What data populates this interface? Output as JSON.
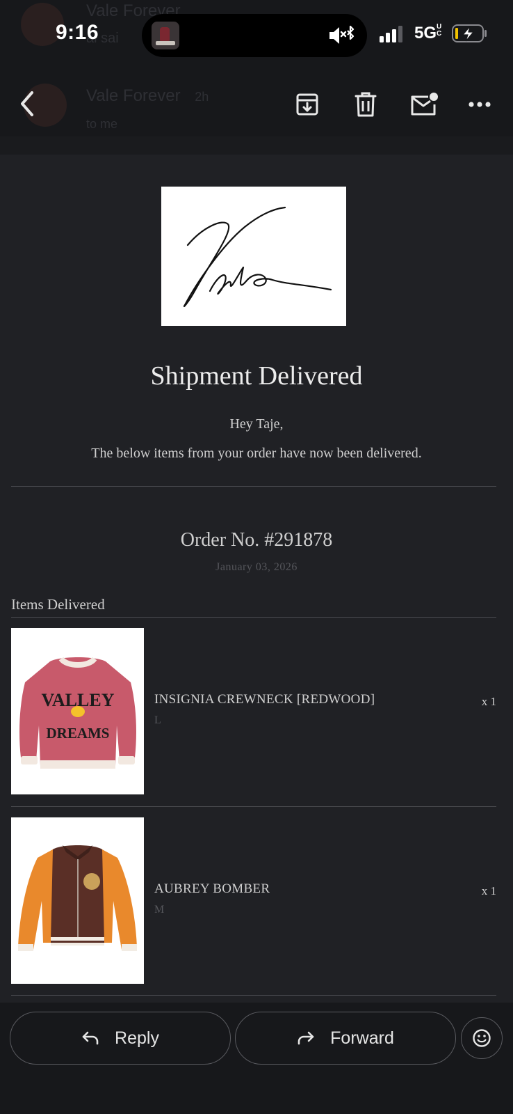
{
  "status_bar": {
    "time": "9:16",
    "network": "5G",
    "network_suffix": "UC"
  },
  "header_ghost": {
    "sender_top": "Vale Forever",
    "subject_top": "ai sai",
    "sender": "Vale Forever",
    "sender_meta": "2h",
    "recipient": "to me"
  },
  "toolbar": {
    "back_icon": "chevron-left-icon",
    "archive_icon": "archive-icon",
    "delete_icon": "trash-icon",
    "mark_unread_icon": "mail-unread-icon",
    "more_icon": "more-horizontal-icon"
  },
  "email": {
    "logo_alt": "Vale",
    "title": "Shipment Delivered",
    "greeting": "Hey Taje,",
    "message": "The below items from your order have now been delivered.",
    "order_number": "Order No. #291878",
    "order_date": "January 03, 2026",
    "items_heading": "Items Delivered",
    "items": [
      {
        "name": "INSIGNIA CREWNECK [REDWOOD]",
        "size": "L",
        "qty": "x 1",
        "image": "pink-crewneck-sweatshirt",
        "image_text_top": "VALLEY",
        "image_text_bottom": "DREAMS"
      },
      {
        "name": "AUBREY BOMBER",
        "size": "M",
        "qty": "x 1",
        "image": "brown-orange-bomber-jacket"
      }
    ]
  },
  "actions": {
    "reply_label": "Reply",
    "forward_label": "Forward",
    "reply_icon": "reply-icon",
    "forward_icon": "forward-icon",
    "emoji_icon": "emoji-icon"
  },
  "colors": {
    "background": "#202125",
    "bar": "#17181b",
    "text": "#cfcfcf",
    "muted": "#55565b",
    "divider": "#4a4b50"
  }
}
